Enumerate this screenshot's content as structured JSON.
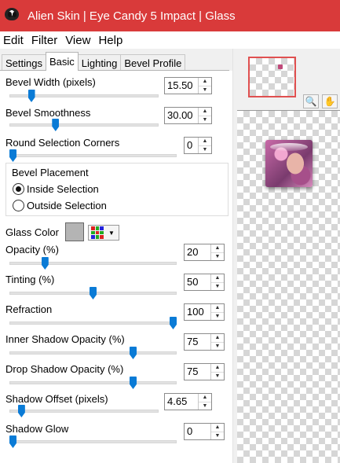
{
  "window": {
    "title": "Alien Skin | Eye Candy 5 Impact | Glass"
  },
  "menu": {
    "edit": "Edit",
    "filter": "Filter",
    "view": "View",
    "help": "Help"
  },
  "tabs": [
    "Settings",
    "Basic",
    "Lighting",
    "Bevel Profile"
  ],
  "active_tab": "Basic",
  "controls": {
    "bevel_width": {
      "label": "Bevel Width (pixels)",
      "value": "15.50",
      "slider": 0.13
    },
    "bevel_smoothness": {
      "label": "Bevel Smoothness",
      "value": "30.00",
      "slider": 0.3
    },
    "round_corners": {
      "label": "Round Selection Corners",
      "value": "0",
      "slider": 0.0
    },
    "opacity": {
      "label": "Opacity (%)",
      "value": "20",
      "slider": 0.2
    },
    "tinting": {
      "label": "Tinting (%)",
      "value": "50",
      "slider": 0.5
    },
    "refraction": {
      "label": "Refraction",
      "value": "100",
      "slider": 1.0
    },
    "inner_shadow": {
      "label": "Inner Shadow Opacity (%)",
      "value": "75",
      "slider": 0.75
    },
    "drop_shadow": {
      "label": "Drop Shadow Opacity (%)",
      "value": "75",
      "slider": 0.75
    },
    "shadow_offset": {
      "label": "Shadow Offset (pixels)",
      "value": "4.65",
      "slider": 0.06
    },
    "shadow_glow": {
      "label": "Shadow Glow",
      "value": "0",
      "slider": 0.0
    }
  },
  "bevel_placement": {
    "label": "Bevel Placement",
    "options": [
      "Inside Selection",
      "Outside Selection"
    ],
    "selected": "Inside Selection"
  },
  "glass_color": {
    "label": "Glass Color",
    "value": "#b4b4b4"
  },
  "colors": {
    "titlebar": "#d93a3a",
    "slider_thumb": "#0a7bd6",
    "nav_frame": "#e05050"
  },
  "icons": {
    "app": "alien-icon",
    "picker": "color-grid-icon",
    "zoom": "zoom-icon",
    "hand": "hand-icon"
  }
}
